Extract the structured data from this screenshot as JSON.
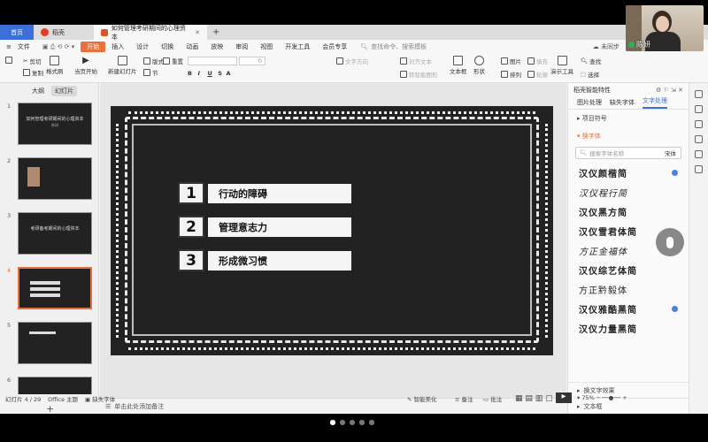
{
  "tabs": {
    "home": "首页",
    "docer": "稻壳",
    "doc": "如何管理考研期间的心理资本"
  },
  "menu": {
    "file": "文件",
    "items": [
      "开始",
      "插入",
      "设计",
      "切换",
      "动画",
      "放映",
      "审阅",
      "视图",
      "开发工具",
      "会员专享"
    ],
    "search_placeholder": "查找命令、搜索模板",
    "cloud": "未同步"
  },
  "toolbar": {
    "cut": "剪切",
    "copy": "复制",
    "format_painter": "格式刷",
    "paste": "粘贴",
    "play_from_start": "当页开始",
    "new_slide": "新建幻灯片",
    "layout": "版式",
    "section": "节",
    "reset": "重置",
    "text_direction": "文字方向",
    "align_text": "对齐文本",
    "convert_smartart": "转智能图形",
    "textbox": "文本框",
    "shape": "形状",
    "arrange": "排列",
    "outline": "轮廓",
    "picture": "图片",
    "fill": "填充",
    "find": "查找",
    "replace": "替换",
    "presenter_tools": "演示工具",
    "select": "选择",
    "font_size": "0"
  },
  "left_panel": {
    "tab_outline": "大纲",
    "tab_slides": "幻灯片",
    "slides": [
      {
        "num": "1",
        "t1": "如何管理考研期间的心理资本",
        "t2": "陈研"
      },
      {
        "num": "2",
        "t1": "",
        "t2": ""
      },
      {
        "num": "3",
        "t1": "考研备考期间的心理资本",
        "t2": ""
      },
      {
        "num": "4",
        "t1": "",
        "t2": ""
      },
      {
        "num": "5",
        "t1": "",
        "t2": ""
      },
      {
        "num": "6",
        "t1": "",
        "t2": ""
      }
    ]
  },
  "slide": {
    "items": [
      {
        "num": "1",
        "label": "行动的障碍"
      },
      {
        "num": "2",
        "label": "管理意志力"
      },
      {
        "num": "3",
        "label": "形成微习惯"
      }
    ]
  },
  "notes_placeholder": "单击此处添加备注",
  "right_panel": {
    "title": "稻壳智能特性",
    "tabs": [
      "图片处理",
      "缺失字体",
      "文字处理"
    ],
    "section_bullets": "项目符号",
    "section_font": "换字体",
    "font_search_placeholder": "搜索字体名称",
    "font_dropdown": "宋体",
    "fonts": [
      {
        "name": "汉仪颜楷简",
        "badge": true
      },
      {
        "name": "汉仪程行简",
        "badge": false
      },
      {
        "name": "汉仪黑方简",
        "badge": false
      },
      {
        "name": "汉仪雪君体简",
        "badge": false
      },
      {
        "name": "方正金福体",
        "badge": false
      },
      {
        "name": "汉仪综艺体简",
        "badge": false
      },
      {
        "name": "方正黔毅体",
        "badge": false
      },
      {
        "name": "汉仪雅酷黑简",
        "badge": true
      },
      {
        "name": "汉仪力量黑简",
        "badge": false
      }
    ],
    "footer1": "换文字效果",
    "footer2": "文本框"
  },
  "status": {
    "slide_count": "幻灯片 4 / 29",
    "theme": "Office 主题",
    "missing_fonts": "缺失字体",
    "smart_beautify": "智能美化",
    "notes": "备注",
    "comments": "批注",
    "zoom": "75%"
  },
  "webcam": {
    "name": "陈妍"
  }
}
